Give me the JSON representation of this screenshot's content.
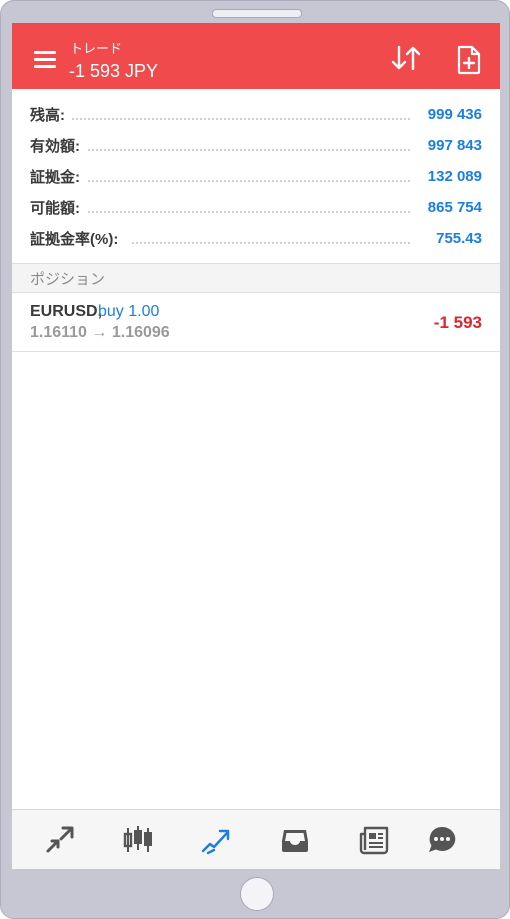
{
  "appbar": {
    "title": "トレード",
    "subtitle": "-1 593 JPY",
    "color": "#f04a4c"
  },
  "account": [
    {
      "label": "残高:",
      "value": "999 436"
    },
    {
      "label": "有効額:",
      "value": "997 843"
    },
    {
      "label": "証拠金:",
      "value": "132 089"
    },
    {
      "label": "可能額:",
      "value": "865 754"
    },
    {
      "label": "証拠金率(%):",
      "value": "755.43"
    }
  ],
  "section": {
    "title": "ポジション"
  },
  "positions": [
    {
      "symbol": "EURUSD,",
      "type": "buy 1.00",
      "prices": "1.16110 → 1.16096",
      "profit": "-1 593"
    }
  ],
  "bottom_nav": [
    {
      "icon": "quotes-icon",
      "active": false
    },
    {
      "icon": "chart-icon",
      "active": false
    },
    {
      "icon": "trade-icon",
      "active": true
    },
    {
      "icon": "history-icon",
      "active": false
    },
    {
      "icon": "news-icon",
      "active": false
    },
    {
      "icon": "chat-icon",
      "active": false
    }
  ],
  "colors": {
    "accent_blue": "#1a7fe0",
    "loss_red": "#d9272d",
    "icon_gray": "#555555"
  }
}
